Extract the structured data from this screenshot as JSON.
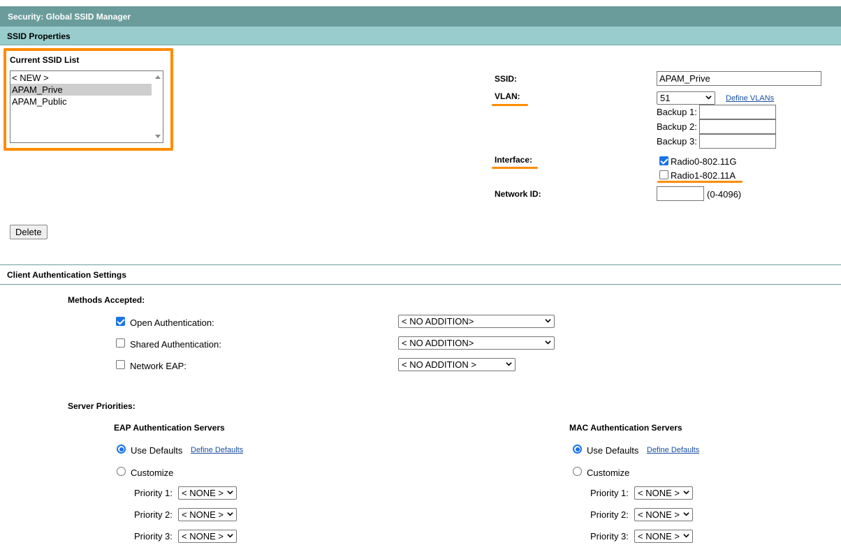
{
  "header": {
    "title": "Security: Global SSID Manager"
  },
  "ssid_properties": {
    "section_title": "SSID Properties",
    "list_title": "Current SSID List",
    "ssid_list": [
      "< NEW >",
      "APAM_Prive",
      "APAM_Public"
    ],
    "selected_index": 1,
    "delete_label": "Delete",
    "ssid_label": "SSID:",
    "ssid_value": "APAM_Prive",
    "vlan_label": "VLAN:",
    "vlan_value": "51",
    "define_vlans_link": "Define VLANs",
    "backup1_label": "Backup 1:",
    "backup2_label": "Backup 2:",
    "backup3_label": "Backup 3:",
    "backup1_value": "",
    "backup2_value": "",
    "backup3_value": "",
    "interface_label": "Interface:",
    "radio0_label": "Radio0-802.11G",
    "radio0_checked": true,
    "radio1_label": "Radio1-802.11A",
    "radio1_checked": false,
    "network_id_label": "Network ID:",
    "network_id_value": "",
    "network_id_range": "(0-4096)"
  },
  "client_auth": {
    "section_title": "Client Authentication Settings",
    "methods_title": "Methods Accepted:",
    "open_auth_label": "Open Authentication:",
    "open_auth_checked": true,
    "open_auth_select": "< NO ADDITION>",
    "shared_auth_label": "Shared Authentication:",
    "shared_auth_checked": false,
    "shared_auth_select": "< NO ADDITION>",
    "network_eap_label": "Network EAP:",
    "network_eap_checked": false,
    "network_eap_select": "< NO ADDITION >",
    "server_priorities_title": "Server Priorities:",
    "eap": {
      "title": "EAP Authentication Servers",
      "use_defaults_label": "Use Defaults",
      "define_defaults_link": "Define Defaults",
      "customize_label": "Customize",
      "priority1_label": "Priority 1:",
      "priority2_label": "Priority 2:",
      "priority3_label": "Priority 3:",
      "priority1_value": "< NONE >",
      "priority2_value": "< NONE >",
      "priority3_value": "< NONE >"
    },
    "mac": {
      "title": "MAC Authentication Servers",
      "use_defaults_label": "Use Defaults",
      "define_defaults_link": "Define Defaults",
      "customize_label": "Customize",
      "priority1_label": "Priority 1:",
      "priority2_label": "Priority 2:",
      "priority3_label": "Priority 3:",
      "priority1_value": "< NONE >",
      "priority2_value": "< NONE >",
      "priority3_value": "< NONE >"
    }
  },
  "colors": {
    "header_bg": "#6a9c9c",
    "section_bg": "#99cccc",
    "annotation_orange": "#ff8c00",
    "link_blue": "#1a4fa0",
    "check_blue": "#1a73e8"
  }
}
